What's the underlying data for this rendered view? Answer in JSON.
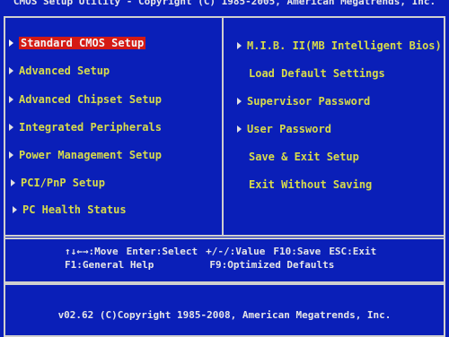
{
  "title": "CMOS Setup Utility - Copyright (C) 1985-2005, American Megatrends, Inc.",
  "left_menu": [
    {
      "label": "Standard CMOS Setup",
      "selected": true
    },
    {
      "label": "Advanced Setup"
    },
    {
      "label": "Advanced Chipset Setup"
    },
    {
      "label": "Integrated Peripherals"
    },
    {
      "label": "Power Management Setup"
    },
    {
      "label": "PCI/PnP Setup"
    },
    {
      "label": "PC Health Status"
    }
  ],
  "right_menu": [
    {
      "label": "M.I.B. II(MB Intelligent Bios)",
      "arrow": true
    },
    {
      "label": "Load Default Settings",
      "arrow": false
    },
    {
      "label": "Supervisor Password",
      "arrow": true
    },
    {
      "label": "User Password",
      "arrow": true
    },
    {
      "label": "Save & Exit Setup",
      "arrow": false
    },
    {
      "label": "Exit Without Saving",
      "arrow": false
    }
  ],
  "help": {
    "line1": [
      "↑↓←→:Move",
      "Enter:Select",
      "+/-/:Value",
      "F10:Save",
      "ESC:Exit"
    ],
    "line2": [
      "F1:General Help",
      "F9:Optimized Defaults"
    ]
  },
  "footer": "v02.62 (C)Copyright 1985-2008, American Megatrends, Inc.",
  "colors": {
    "background": "#0a1fb8",
    "menu_text": "#d8dc4a",
    "highlight": "#d41a14",
    "border": "#cfcfcf"
  }
}
